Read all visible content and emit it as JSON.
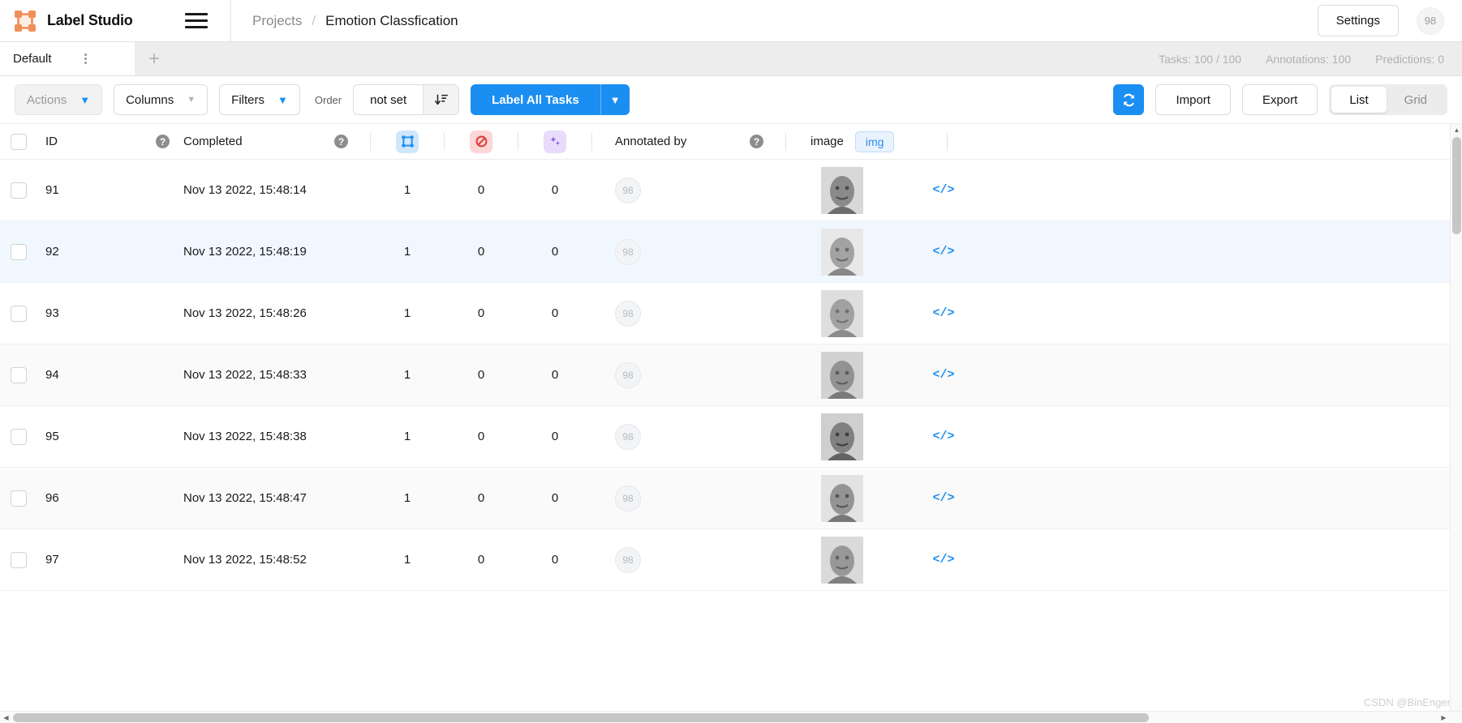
{
  "app": {
    "brand_name": "Label Studio",
    "logo_icon": "bounding-box-icon",
    "menu_icon": "hamburger-icon"
  },
  "breadcrumb": {
    "parent": "Projects",
    "separator": "/",
    "current": "Emotion Classfication"
  },
  "header": {
    "settings_label": "Settings",
    "avatar_initials": "98"
  },
  "tabs": {
    "items": [
      {
        "label": "Default",
        "active": true
      }
    ],
    "menu_icon": "three-dots-vertical-icon",
    "add_label": "+",
    "stats": {
      "tasks": "Tasks: 100 / 100",
      "annotations": "Annotations: 100",
      "predictions": "Predictions: 0"
    }
  },
  "toolbar": {
    "actions_label": "Actions",
    "columns_label": "Columns",
    "filters_label": "Filters",
    "order_label": "Order",
    "order_value": "not set",
    "sort_icon": "sort-descending-icon",
    "label_all_label": "Label All Tasks",
    "refresh_icon": "refresh-icon",
    "import_label": "Import",
    "export_label": "Export",
    "view_modes": [
      {
        "label": "List",
        "active": true
      },
      {
        "label": "Grid",
        "active": false
      }
    ]
  },
  "table": {
    "columns": {
      "id": "ID",
      "completed": "Completed",
      "annotations_icon": "annotations-box-icon",
      "cancelled_icon": "cancelled-slash-icon",
      "predictions_icon": "predictions-sparkles-icon",
      "annotated_by": "Annotated by",
      "image": "image",
      "image_badge": "img",
      "help_icon": "help-circle-icon",
      "code_icon": "code-brackets-icon"
    },
    "rows": [
      {
        "id": "91",
        "completed": "Nov 13 2022, 15:48:14",
        "annotations": "1",
        "cancelled": "0",
        "predictions": "0",
        "annotator": "98"
      },
      {
        "id": "92",
        "completed": "Nov 13 2022, 15:48:19",
        "annotations": "1",
        "cancelled": "0",
        "predictions": "0",
        "annotator": "98"
      },
      {
        "id": "93",
        "completed": "Nov 13 2022, 15:48:26",
        "annotations": "1",
        "cancelled": "0",
        "predictions": "0",
        "annotator": "98"
      },
      {
        "id": "94",
        "completed": "Nov 13 2022, 15:48:33",
        "annotations": "1",
        "cancelled": "0",
        "predictions": "0",
        "annotator": "98"
      },
      {
        "id": "95",
        "completed": "Nov 13 2022, 15:48:38",
        "annotations": "1",
        "cancelled": "0",
        "predictions": "0",
        "annotator": "98"
      },
      {
        "id": "96",
        "completed": "Nov 13 2022, 15:48:47",
        "annotations": "1",
        "cancelled": "0",
        "predictions": "0",
        "annotator": "98"
      },
      {
        "id": "97",
        "completed": "Nov 13 2022, 15:48:52",
        "annotations": "1",
        "cancelled": "0",
        "predictions": "0",
        "annotator": "98"
      }
    ],
    "code_glyph": "</>"
  },
  "watermark": "CSDN @BinEnger",
  "colors": {
    "accent_blue": "#1b8ef2",
    "brand_orange": "#ef8f5a",
    "row_highlight": "#f1f7fe"
  }
}
